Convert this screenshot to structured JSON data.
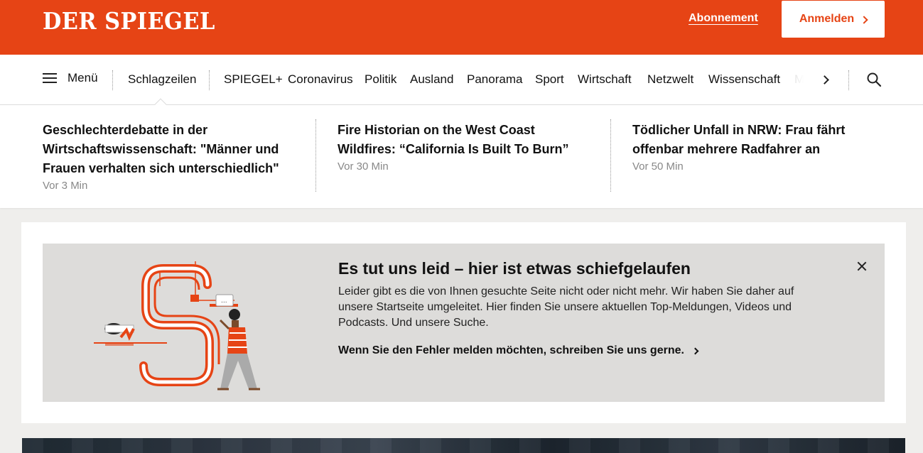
{
  "header": {
    "logo": "DER SPIEGEL",
    "subscription_label": "Abonnement",
    "login_label": "Anmelden",
    "brand_color": "#e64415"
  },
  "nav": {
    "menu_label": "Menü",
    "active": "Schlagzeilen",
    "items": [
      "Schlagzeilen",
      "SPIEGEL+",
      "Coronavirus",
      "Politik",
      "Ausland",
      "Panorama",
      "Sport",
      "Wirtschaft",
      "Netzwelt",
      "Wissenschaft",
      "M"
    ]
  },
  "headlines": [
    {
      "title": "Geschlechterdebatte in der Wirtschaftswissenschaft: \"Männer und Frauen verhalten sich unterschiedlich\"",
      "time": "Vor 3 Min"
    },
    {
      "title": "Fire Historian on the West Coast Wildfires: “California Is Built To Burn”",
      "time": "Vor 30 Min"
    },
    {
      "title": "Tödlicher Unfall in NRW: Frau fährt offenbar mehrere Radfahrer an",
      "time": "Vor 50 Min"
    }
  ],
  "error": {
    "title": "Es tut uns leid – hier ist etwas schiefgelaufen",
    "text": "Leider gibt es die von Ihnen gesuchte Seite nicht oder nicht mehr. Wir haben Sie daher auf unsere Startseite umgeleitet. Hier finden Sie unsere aktuellen Top-Meldungen, Videos und Podcasts. Und unsere Suche.",
    "link_label": "Wenn Sie den Fehler melden möchten, schreiben Sie uns gerne.",
    "speech_bubble": "..."
  }
}
